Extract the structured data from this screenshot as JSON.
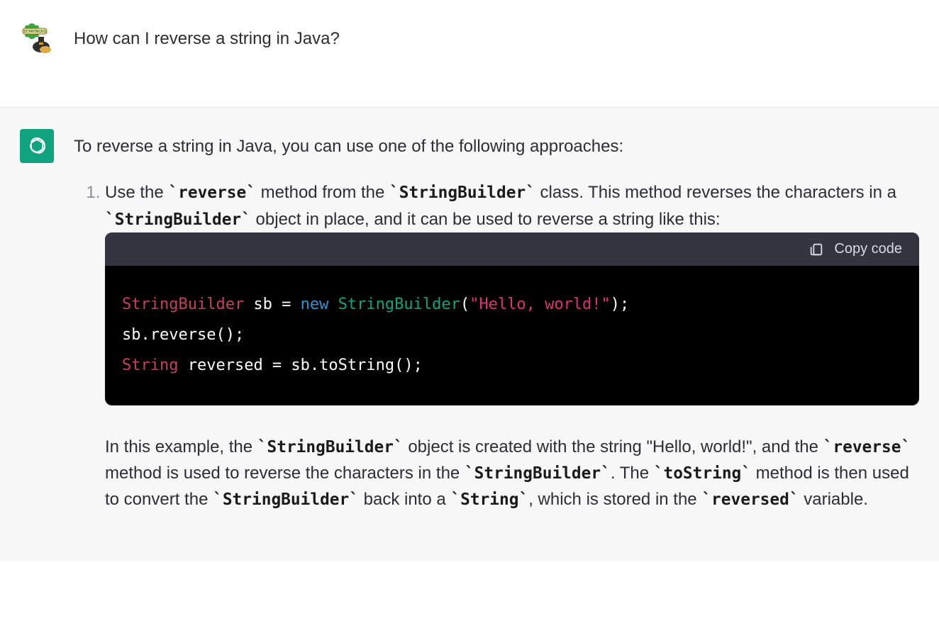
{
  "conversation": {
    "user_message": "How can I reverse a string in Java?",
    "assistant_intro": "To reverse a string in Java, you can use one of the following approaches:",
    "list_number": "1.",
    "item1_parts": {
      "a": "Use the ",
      "code_a": "`reverse`",
      "b": " method from the ",
      "code_b": "`StringBuilder`",
      "c": " class. This method reverses the characters in a ",
      "code_c": "`StringBuilder`",
      "d": " object in place, and it can be used to reverse a string like this:"
    },
    "copy_label": "Copy code",
    "code_tokens": {
      "l1_t1": "StringBuilder",
      "l1_t2": " sb = ",
      "l1_t3": "new",
      "l1_t4": " ",
      "l1_t5": "StringBuilder",
      "l1_t6": "(",
      "l1_t7": "\"Hello, world!\"",
      "l1_t8": ");",
      "l2": "sb.reverse();",
      "l3_t1": "String",
      "l3_t2": " reversed = sb.toString();"
    },
    "explain_parts": {
      "a": "In this example, the ",
      "code_a": "`StringBuilder`",
      "b": " object is created with the string \"Hello, world!\", and the ",
      "code_b": "`reverse`",
      "c": " method is used to reverse the characters in the ",
      "code_c": "`StringBuilder`",
      "d": ". The ",
      "code_d": "`toString`",
      "e": " method is then used to convert the ",
      "code_e": "`StringBuilder`",
      "f": " back into a ",
      "code_f": "`String`",
      "g": ", which is stored in the ",
      "code_g": "`reversed`",
      "h": " variable."
    }
  }
}
